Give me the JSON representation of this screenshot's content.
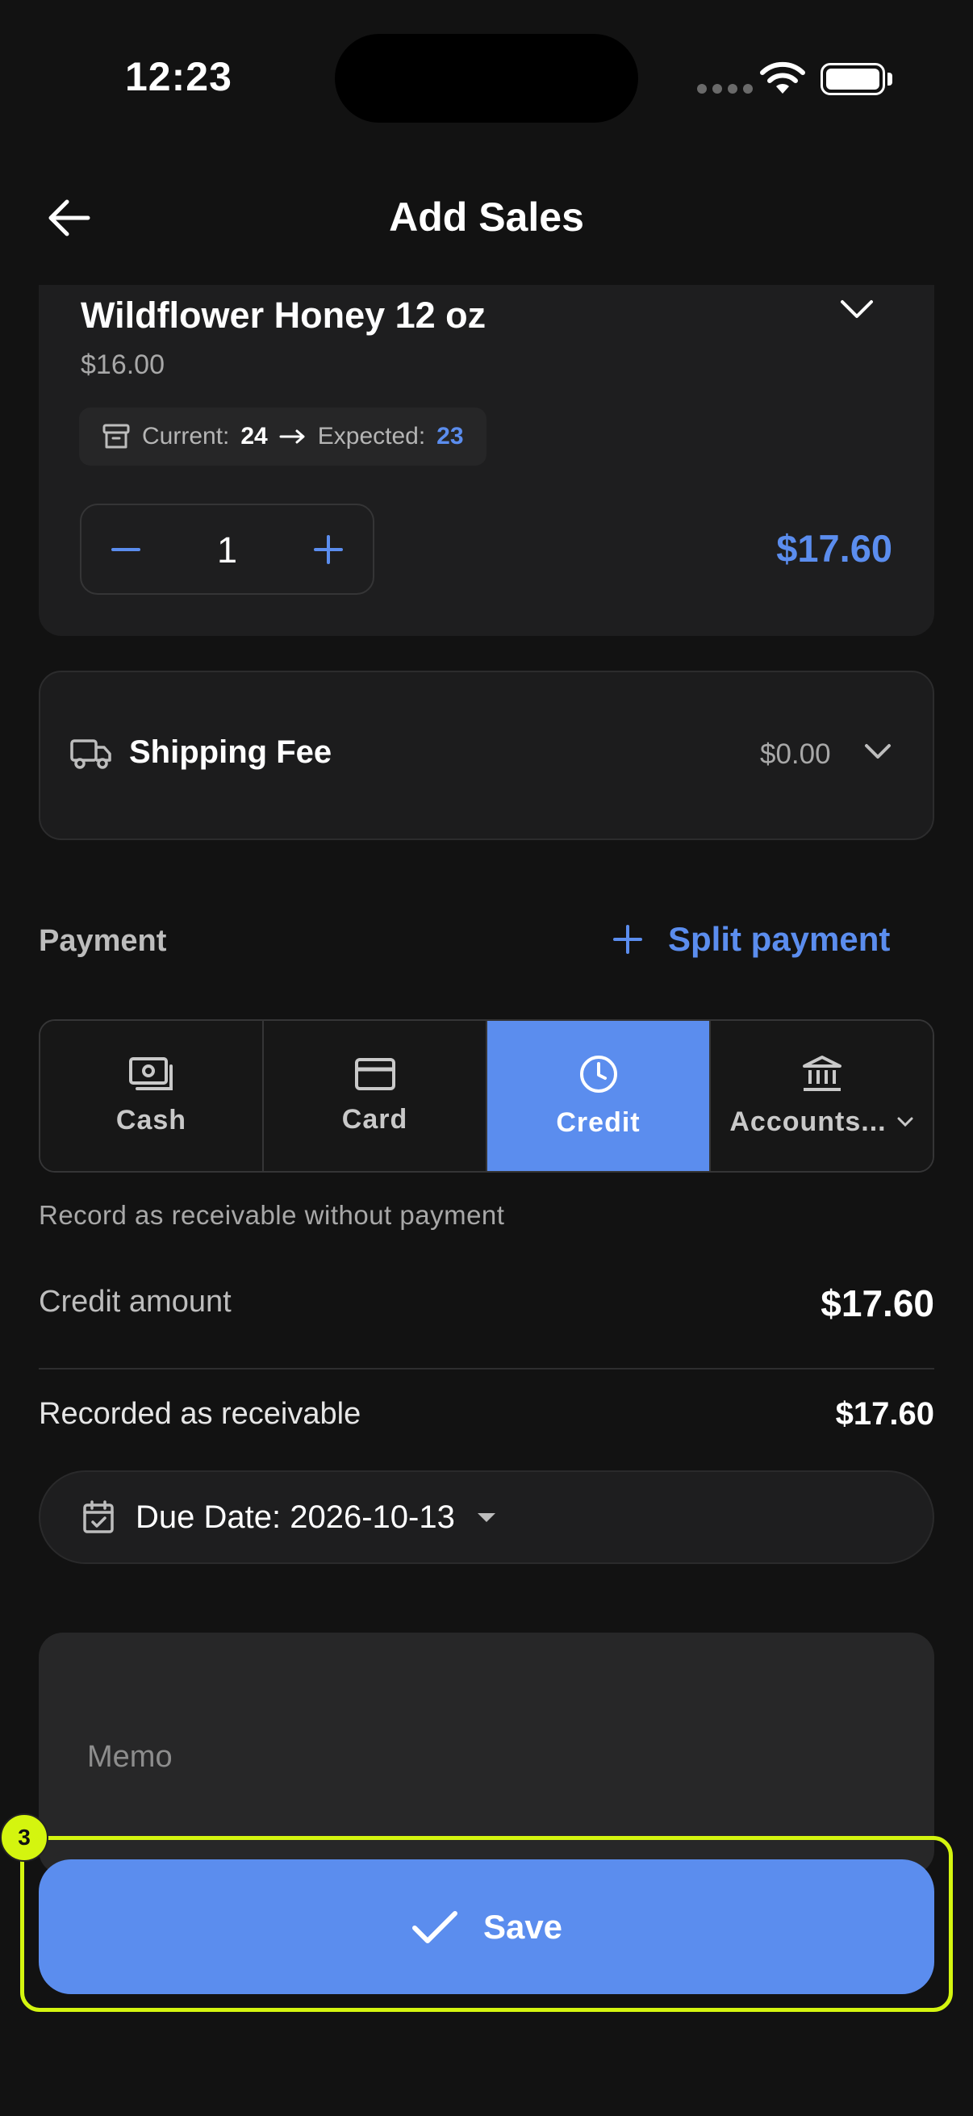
{
  "status_bar": {
    "time": "12:23"
  },
  "header": {
    "title": "Add Sales",
    "back_icon": "arrow-left-icon"
  },
  "product": {
    "name": "Wildflower Honey 12 oz",
    "price": "$16.00",
    "stock": {
      "current_label": "Current:",
      "current": "24",
      "expected_label": "Expected:",
      "expected": "23"
    },
    "quantity": "1",
    "line_total": "$17.60"
  },
  "shipping": {
    "label": "Shipping Fee",
    "value": "$0.00"
  },
  "payment": {
    "title": "Payment",
    "split_label": "Split payment",
    "methods": [
      {
        "label": "Cash",
        "icon": "cash-icon"
      },
      {
        "label": "Card",
        "icon": "card-icon"
      },
      {
        "label": "Credit",
        "icon": "clock-icon",
        "active": true
      },
      {
        "label": "Accounts...",
        "icon": "bank-icon"
      }
    ],
    "hint": "Record as receivable without payment",
    "credit_label": "Credit amount",
    "credit_value": "$17.60",
    "receivable_label": "Recorded as receivable",
    "receivable_value": "$17.60",
    "due_date": "Due Date: 2026-10-13"
  },
  "memo": {
    "placeholder": "Memo"
  },
  "save": {
    "label": "Save"
  },
  "overlay": {
    "badge": "3",
    "highlight_color": "#d4f50f"
  },
  "colors": {
    "accent": "#5b8dee",
    "background": "#121212"
  }
}
